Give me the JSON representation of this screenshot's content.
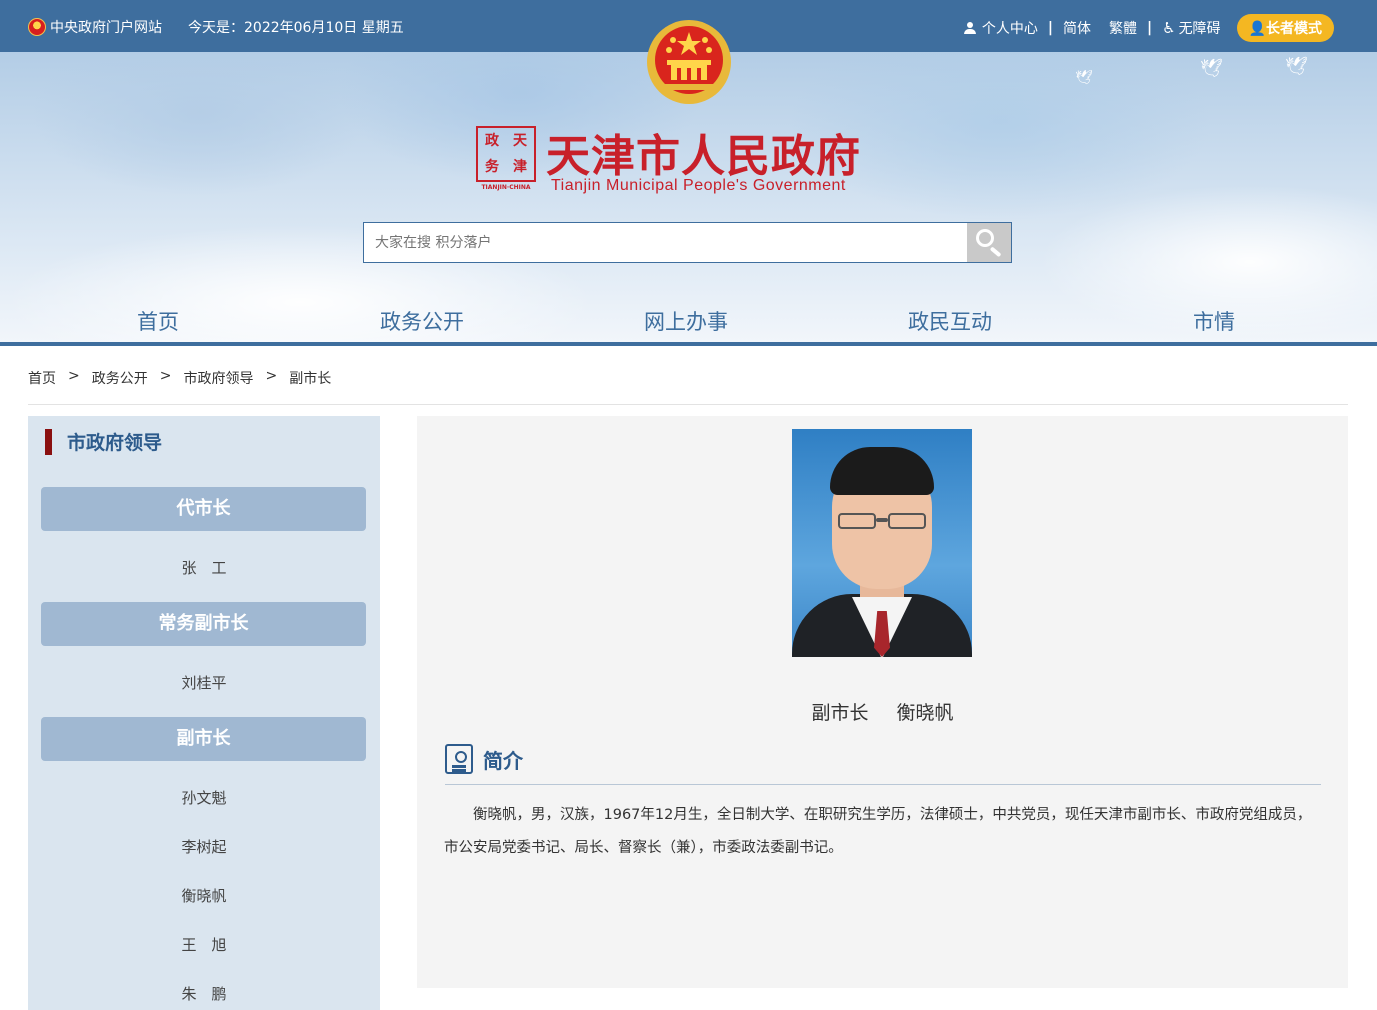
{
  "topbar": {
    "portal_link": "中央政府门户网站",
    "date_text": "今天是：2022年06月10日 星期五",
    "personal_center": "个人中心",
    "separator": "|",
    "simplified": "简体",
    "traditional": "繁體",
    "accessibility": "无障碍",
    "elder_mode": "长者模式"
  },
  "header": {
    "logo_seal_chars": [
      "政",
      "天",
      "务",
      "津"
    ],
    "logo_seal_sub": "TIANJIN·CHINA",
    "title": "天津市人民政府",
    "subtitle": "Tianjin Municipal People's Government"
  },
  "search": {
    "placeholder": "大家在搜 积分落户"
  },
  "nav": {
    "items": [
      "首页",
      "政务公开",
      "网上办事",
      "政民互动",
      "市情"
    ]
  },
  "breadcrumb": {
    "items": [
      "首页",
      "政务公开",
      "市政府领导",
      "副市长"
    ],
    "sep": ">"
  },
  "sidebar": {
    "title": "市政府领导",
    "groups": [
      {
        "label": "代市长",
        "people": [
          "张　工"
        ]
      },
      {
        "label": "常务副市长",
        "people": [
          "刘桂平"
        ]
      },
      {
        "label": "副市长",
        "people": [
          "孙文魁",
          "李树起",
          "衡晓帆",
          "王　旭",
          "朱　鹏"
        ]
      }
    ]
  },
  "profile": {
    "role": "副市长",
    "name": "衡晓帆",
    "intro_heading": "简介",
    "bio": "衡晓帆，男，汉族，1967年12月生，全日制大学、在职研究生学历，法律硕士，中共党员，现任天津市副市长、市政府党组成员，市公安局党委书记、局长、督察长（兼），市委政法委副书记。"
  },
  "colors": {
    "primary_blue": "#3e6e9e",
    "title_red": "#c8202a",
    "sidebar_bg": "#dae5ef",
    "group_btn": "#a0b8d2",
    "elder_btn": "#f4b722"
  }
}
